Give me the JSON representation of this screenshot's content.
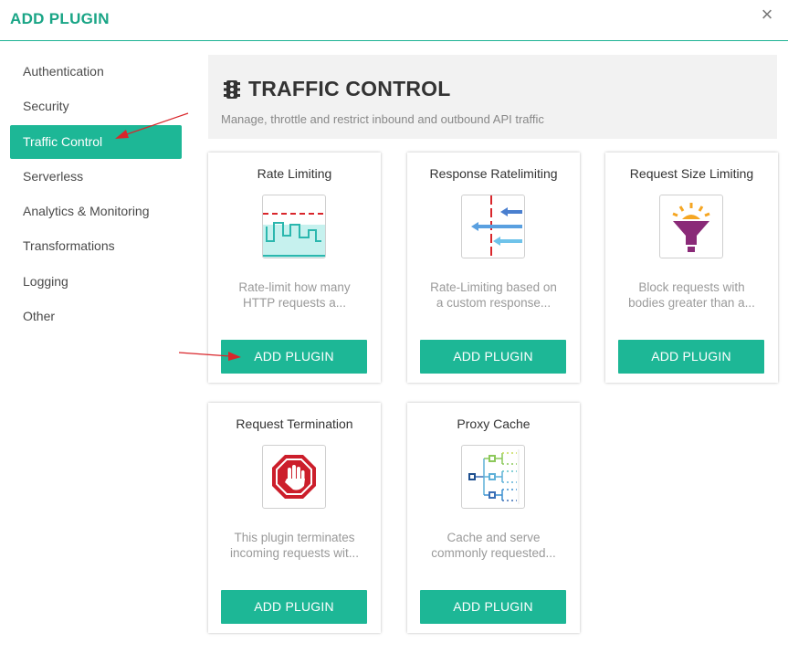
{
  "header": {
    "title": "ADD PLUGIN",
    "close_label": "×"
  },
  "sidebar": {
    "items": [
      {
        "label": "Authentication",
        "active": false
      },
      {
        "label": "Security",
        "active": false
      },
      {
        "label": "Traffic Control",
        "active": true
      },
      {
        "label": "Serverless",
        "active": false
      },
      {
        "label": "Analytics & Monitoring",
        "active": false
      },
      {
        "label": "Transformations",
        "active": false
      },
      {
        "label": "Logging",
        "active": false
      },
      {
        "label": "Other",
        "active": false
      }
    ]
  },
  "category": {
    "title": "TRAFFIC CONTROL",
    "icon": "traffic-light-icon",
    "subtitle": "Manage, throttle and restrict inbound and outbound API traffic"
  },
  "plugins": [
    {
      "title": "Rate Limiting",
      "icon": "rate-limiting-icon",
      "desc1": "Rate-limit how many",
      "desc2": "HTTP requests a...",
      "button": "ADD PLUGIN"
    },
    {
      "title": "Response Ratelimiting",
      "icon": "response-ratelimiting-icon",
      "desc1": "Rate-Limiting based on",
      "desc2": "a custom response...",
      "button": "ADD PLUGIN"
    },
    {
      "title": "Request Size Limiting",
      "icon": "funnel-icon",
      "desc1": "Block requests with",
      "desc2": "bodies greater than a...",
      "button": "ADD PLUGIN"
    },
    {
      "title": "Request Termination",
      "icon": "stop-hand-icon",
      "desc1": "This plugin terminates",
      "desc2": "incoming requests wit...",
      "button": "ADD PLUGIN"
    },
    {
      "title": "Proxy Cache",
      "icon": "tree-network-icon",
      "desc1": "Cache and serve",
      "desc2": "commonly requested...",
      "button": "ADD PLUGIN"
    }
  ],
  "colors": {
    "accent": "#1db796",
    "annotation_arrow": "#d9262b"
  }
}
